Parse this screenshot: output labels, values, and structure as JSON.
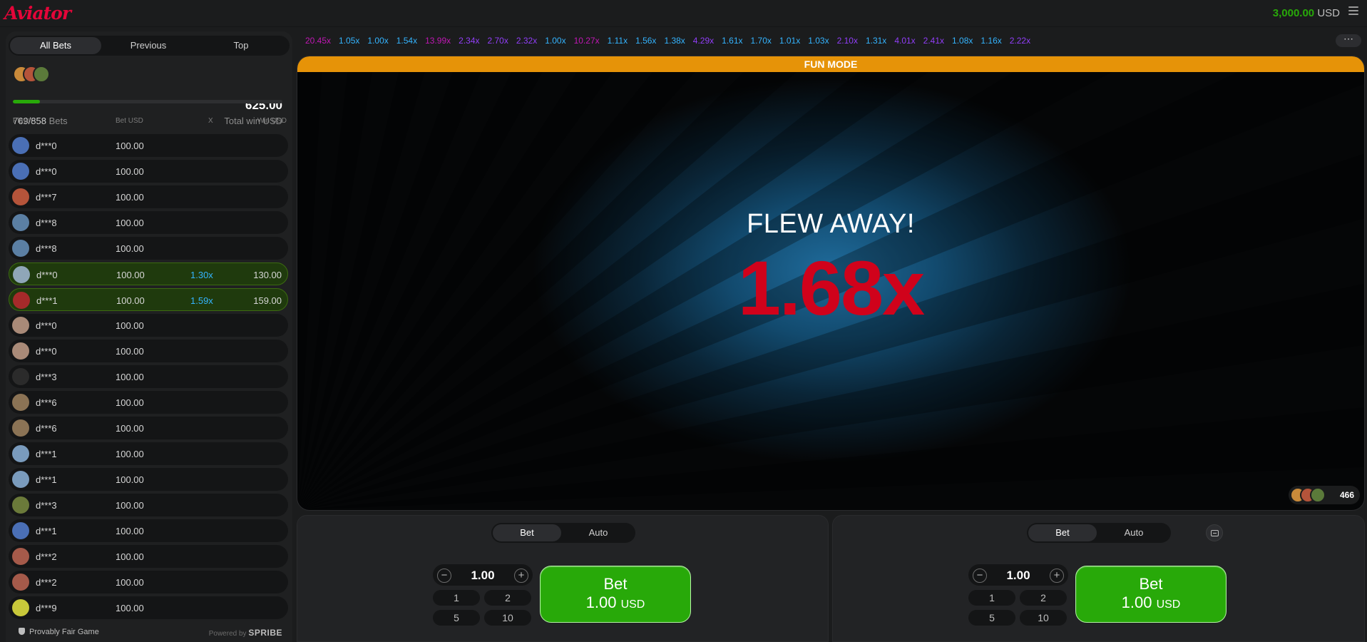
{
  "header": {
    "logo": "Aviator",
    "balance_amount": "3,000.00",
    "balance_currency": "USD"
  },
  "bets_panel": {
    "tabs": [
      "All Bets",
      "Previous",
      "Top"
    ],
    "active_tab": "All Bets",
    "bets_count": "769/858",
    "bets_label": "Bets",
    "total_win": "625.00",
    "total_win_label": "Total win USD",
    "progress_fraction": 0.1,
    "columns": [
      "Player",
      "Bet USD",
      "X",
      "Win USD"
    ],
    "rows": [
      {
        "player": "d***0",
        "bet": "100.00",
        "x": "",
        "win": "",
        "won": false,
        "avatar": "#4a6fb5"
      },
      {
        "player": "d***0",
        "bet": "100.00",
        "x": "",
        "win": "",
        "won": false,
        "avatar": "#4a6fb5"
      },
      {
        "player": "d***7",
        "bet": "100.00",
        "x": "",
        "win": "",
        "won": false,
        "avatar": "#b5543a"
      },
      {
        "player": "d***8",
        "bet": "100.00",
        "x": "",
        "win": "",
        "won": false,
        "avatar": "#5b7fa3"
      },
      {
        "player": "d***8",
        "bet": "100.00",
        "x": "",
        "win": "",
        "won": false,
        "avatar": "#5b7fa3"
      },
      {
        "player": "d***0",
        "bet": "100.00",
        "x": "1.30x",
        "win": "130.00",
        "won": true,
        "avatar": "#8fa6b8"
      },
      {
        "player": "d***1",
        "bet": "100.00",
        "x": "1.59x",
        "win": "159.00",
        "won": true,
        "avatar": "#a52a2a"
      },
      {
        "player": "d***0",
        "bet": "100.00",
        "x": "",
        "win": "",
        "won": false,
        "avatar": "#a98a78"
      },
      {
        "player": "d***0",
        "bet": "100.00",
        "x": "",
        "win": "",
        "won": false,
        "avatar": "#a98a78"
      },
      {
        "player": "d***3",
        "bet": "100.00",
        "x": "",
        "win": "",
        "won": false,
        "avatar": "#2b2b2b"
      },
      {
        "player": "d***6",
        "bet": "100.00",
        "x": "",
        "win": "",
        "won": false,
        "avatar": "#8b7355"
      },
      {
        "player": "d***6",
        "bet": "100.00",
        "x": "",
        "win": "",
        "won": false,
        "avatar": "#8b7355"
      },
      {
        "player": "d***1",
        "bet": "100.00",
        "x": "",
        "win": "",
        "won": false,
        "avatar": "#7a9bbd"
      },
      {
        "player": "d***1",
        "bet": "100.00",
        "x": "",
        "win": "",
        "won": false,
        "avatar": "#7a9bbd"
      },
      {
        "player": "d***3",
        "bet": "100.00",
        "x": "",
        "win": "",
        "won": false,
        "avatar": "#6b7a3a"
      },
      {
        "player": "d***1",
        "bet": "100.00",
        "x": "",
        "win": "",
        "won": false,
        "avatar": "#4a6fb5"
      },
      {
        "player": "d***2",
        "bet": "100.00",
        "x": "",
        "win": "",
        "won": false,
        "avatar": "#a55a4a"
      },
      {
        "player": "d***2",
        "bet": "100.00",
        "x": "",
        "win": "",
        "won": false,
        "avatar": "#a55a4a"
      },
      {
        "player": "d***9",
        "bet": "100.00",
        "x": "",
        "win": "",
        "won": false,
        "avatar": "#c8c83a"
      }
    ],
    "footer_left": "Provably Fair Game",
    "footer_right_prefix": "Powered by",
    "footer_right_brand": "SPRIBE"
  },
  "history": [
    {
      "v": "20.45x",
      "c": "#c017b4"
    },
    {
      "v": "1.05x",
      "c": "#34b4ff"
    },
    {
      "v": "1.00x",
      "c": "#34b4ff"
    },
    {
      "v": "1.54x",
      "c": "#34b4ff"
    },
    {
      "v": "13.99x",
      "c": "#c017b4"
    },
    {
      "v": "2.34x",
      "c": "#913ef8"
    },
    {
      "v": "2.70x",
      "c": "#913ef8"
    },
    {
      "v": "2.32x",
      "c": "#913ef8"
    },
    {
      "v": "1.00x",
      "c": "#34b4ff"
    },
    {
      "v": "10.27x",
      "c": "#c017b4"
    },
    {
      "v": "1.11x",
      "c": "#34b4ff"
    },
    {
      "v": "1.56x",
      "c": "#34b4ff"
    },
    {
      "v": "1.38x",
      "c": "#34b4ff"
    },
    {
      "v": "4.29x",
      "c": "#913ef8"
    },
    {
      "v": "1.61x",
      "c": "#34b4ff"
    },
    {
      "v": "1.70x",
      "c": "#34b4ff"
    },
    {
      "v": "1.01x",
      "c": "#34b4ff"
    },
    {
      "v": "1.03x",
      "c": "#34b4ff"
    },
    {
      "v": "2.10x",
      "c": "#913ef8"
    },
    {
      "v": "1.31x",
      "c": "#34b4ff"
    },
    {
      "v": "4.01x",
      "c": "#913ef8"
    },
    {
      "v": "2.41x",
      "c": "#913ef8"
    },
    {
      "v": "1.08x",
      "c": "#34b4ff"
    },
    {
      "v": "1.16x",
      "c": "#34b4ff"
    },
    {
      "v": "2.22x",
      "c": "#913ef8"
    }
  ],
  "game": {
    "mode_banner": "FUN MODE",
    "status": "FLEW AWAY!",
    "multiplier": "1.68x",
    "multiplier_color": "#d0021b",
    "online_players": "466"
  },
  "bet_panels": [
    {
      "tabs": [
        "Bet",
        "Auto"
      ],
      "amount": "1.00",
      "quick": [
        "1",
        "2",
        "5",
        "10"
      ],
      "button_label": "Bet",
      "button_amount": "1.00",
      "button_currency": "USD"
    },
    {
      "tabs": [
        "Bet",
        "Auto"
      ],
      "amount": "1.00",
      "quick": [
        "1",
        "2",
        "5",
        "10"
      ],
      "button_label": "Bet",
      "button_amount": "1.00",
      "button_currency": "USD"
    }
  ],
  "colors": {
    "accent_red": "#e50539",
    "win_green": "#28a909",
    "fun_mode_orange": "#e69308",
    "blue_mult": "#34b4ff",
    "purple_mult": "#913ef8",
    "magenta_mult": "#c017b4"
  }
}
